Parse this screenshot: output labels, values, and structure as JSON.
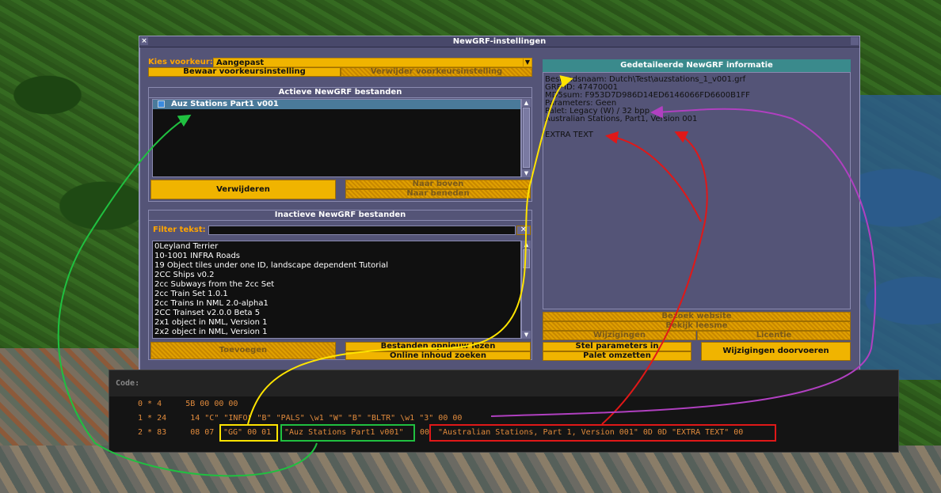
{
  "window": {
    "title": "NewGRF-instellingen"
  },
  "preset": {
    "label": "Kies voorkeur:",
    "value": "Aangepast",
    "save_label": "Bewaar voorkeursinstelling",
    "delete_label": "Verwijder voorkeursinstelling"
  },
  "active": {
    "title": "Actieve NewGRF bestanden",
    "items": [
      "Auz Stations Part1 v001"
    ],
    "remove_label": "Verwijderen",
    "move_up_label": "Naar boven",
    "move_down_label": "Naar beneden"
  },
  "inactive": {
    "title": "Inactieve NewGRF bestanden",
    "filter_label": "Filter tekst:",
    "items": [
      "0Leyland Terrier",
      "10-1001 INFRA Roads",
      "19 Object tiles under one ID, landscape dependent Tutorial",
      "2CC Ships v0.2",
      "2cc Subways from the 2cc Set",
      "2cc Train Set 1.0.1",
      "2cc Trains In NML 2.0-alpha1",
      "2CC Trainset v2.0.0 Beta 5",
      "2x1 object in NML, Version 1",
      "2x2 object in NML, Version 1"
    ],
    "add_label": "Toevoegen",
    "rescan_label": "Bestanden opnieuw lezen",
    "online_label": "Online inhoud zoeken"
  },
  "info": {
    "title": "Gedetaileerde NewGRF informatie",
    "lines": [
      "Bestandsnaam: Dutch\\Test\\auzstations_1_v001.grf",
      "GRF-ID: 47470001",
      "MD5sum: F953D7D986D14ED6146066FD6600B1FF",
      "Parameters: Geen",
      "Palet: Legacy (W) / 32 bpp",
      "Australian Stations, Part1, Version 001"
    ],
    "extra": "EXTRA TEXT",
    "website_label": "Bezoek website",
    "readme_label": "Bekijk leesme",
    "changes_label": "Wijzigingen",
    "license_label": "Licentie",
    "params_label": "Stel parameters in",
    "palette_label": "Palet omzetten",
    "apply_label": "Wijzigingen doorvoeren"
  },
  "code": {
    "header": "Code:",
    "line0": "0 * 4     5B 00 00 00",
    "line1": "1 * 24     14 \"C\" \"INFO\" \"B\" \"PALS\" \\w1 \"W\" \"B\" \"BLTR\" \\w1 \"3\" 00 00",
    "line2_prefix": "2 * 83     08 07",
    "line2_grfid": "\"GG\" 00 01",
    "line2_name": "\"Auz Stations Part1 v001\"",
    "line2_sep": "00",
    "line2_desc": "\"Australian Stations, Part 1, Version 001\" 0D 0D \"EXTRA TEXT\" 00"
  },
  "colors": {
    "annotation_yellow": "#ffe400",
    "annotation_green": "#20c040",
    "annotation_red": "#e01818",
    "annotation_purple": "#b040c0",
    "button_orange": "#f0b400",
    "info_header_teal": "#3a8a8c"
  }
}
